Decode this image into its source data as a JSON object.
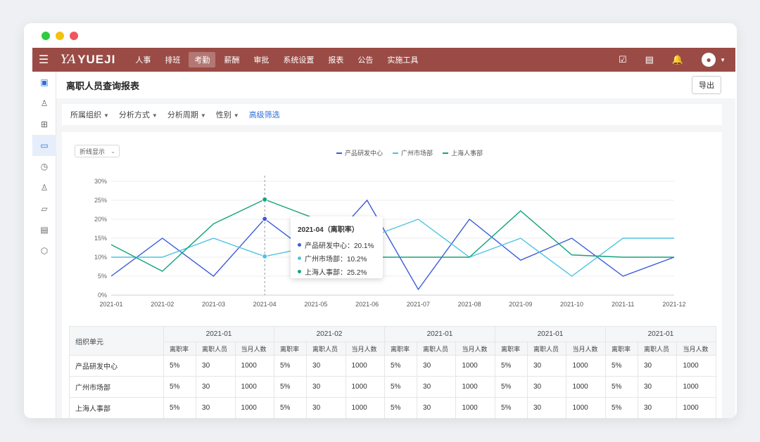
{
  "app": {
    "logo_script": "YA",
    "logo_text": "YUEJI",
    "nav": [
      "人事",
      "排班",
      "考勤",
      "薪酬",
      "审批",
      "系统设置",
      "报表",
      "公告",
      "实施工具"
    ],
    "nav_active_index": 2,
    "brand_color": "#9a4b45"
  },
  "page": {
    "title": "离职人员查询报表",
    "export_label": "导出",
    "filters": [
      "所属组织",
      "分析方式",
      "分析周期",
      "性别"
    ],
    "advanced_filter": "高级筛选",
    "display_select": "折线显示"
  },
  "chart_data": {
    "type": "line",
    "categories": [
      "2021-01",
      "2021-02",
      "2021-03",
      "2021-04",
      "2021-05",
      "2021-06",
      "2021-07",
      "2021-08",
      "2021-09",
      "2021-10",
      "2021-11",
      "2021-12"
    ],
    "y_ticks": [
      "0%",
      "5%",
      "10%",
      "15%",
      "20%",
      "25%",
      "30%"
    ],
    "ylim": [
      0,
      30
    ],
    "series": [
      {
        "name": "产品研发中心",
        "color": "#3d5bdb",
        "values": [
          5,
          15,
          5,
          20.1,
          10,
          25,
          1.5,
          20,
          9.2,
          15,
          5,
          10
        ]
      },
      {
        "name": "广州市场部",
        "color": "#4cc3e3",
        "values": [
          10,
          10,
          15,
          10.2,
          13,
          15,
          20,
          10,
          15,
          5,
          15,
          15
        ]
      },
      {
        "name": "上海人事部",
        "color": "#13a47c",
        "values": [
          13.3,
          6.3,
          18.8,
          25.2,
          20.1,
          10,
          10,
          10,
          22.2,
          10.6,
          10,
          10
        ]
      }
    ],
    "hover_index": 3,
    "tooltip": {
      "title": "2021-04（离职率）",
      "rows": [
        "产品研发中心：20.1%",
        "广州市场部：10.2%",
        "上海人事部：25.2%"
      ]
    }
  },
  "table": {
    "unit_header": "组织单元",
    "periods": [
      "2021-01",
      "2021-02",
      "2021-01",
      "2021-01",
      "2021-01"
    ],
    "sub_headers": [
      "离职率",
      "离职人员",
      "当月人数"
    ],
    "rows": [
      {
        "unit": "产品研发中心",
        "cells": [
          "5%",
          "30",
          "1000"
        ]
      },
      {
        "unit": "广州市场部",
        "cells": [
          "5%",
          "30",
          "1000"
        ]
      },
      {
        "unit": "上海人事部",
        "cells": [
          "5%",
          "30",
          "1000"
        ]
      }
    ]
  }
}
